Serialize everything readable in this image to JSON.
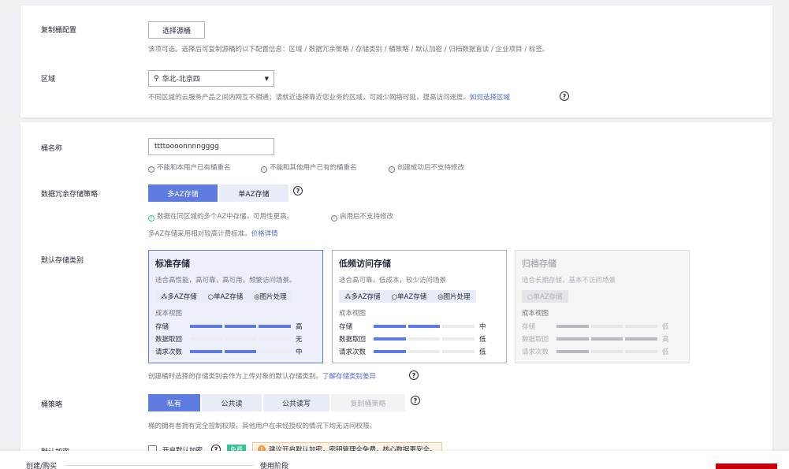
{
  "replicate": {
    "label": "复制桶配置",
    "button": "选择源桶",
    "hint": "该项可选。选择后可复制源桶的以下配置信息：区域 / 数据冗余策略 / 存储类别 / 桶策略 / 默认加密 / 归档数据直读 / 企业项目 / 标签。"
  },
  "region": {
    "label": "区域",
    "value": "华北-北京四",
    "hint": "不同区域的云服务产品之间内网互不相通；请就近选择靠近您业务的区域，可减少网络时延，提高访问速度。",
    "link": "如何选择区域"
  },
  "bucket_name": {
    "label": "桶名称",
    "value": "ttttoooonnnngggg",
    "rules": [
      "不能和本用户已有桶重名",
      "不能和其他用户已有的桶重名",
      "创建成功后不支持修改"
    ]
  },
  "redundancy": {
    "label": "数据冗余存储策略",
    "options": [
      "多AZ存储",
      "单AZ存储"
    ],
    "hint_ok": "数据在同区域的多个AZ中存储，可用性更高。",
    "hint_info": "启用后不支持修改",
    "price_hint": "多AZ存储采用相对较高计费标准。",
    "price_link": "价格详情"
  },
  "storage_class": {
    "label": "默认存储类别",
    "cost_title": "成本视图",
    "cards": [
      {
        "title": "标准存储",
        "desc": "适合高性能，高可靠，高可用，频繁访问场景。",
        "tags": [
          "⁂多AZ存储",
          "○单AZ存储",
          "◎图片处理"
        ],
        "rows": [
          {
            "name": "存储",
            "level": 3,
            "value": "高"
          },
          {
            "name": "数据取回",
            "level": 0,
            "value": "无"
          },
          {
            "name": "请求次数",
            "level": 2,
            "value": "中"
          }
        ]
      },
      {
        "title": "低频访问存储",
        "desc": "适合高可靠，低成本，较少访问场景",
        "tags": [
          "⁂多AZ存储",
          "○单AZ存储",
          "◎图片处理"
        ],
        "rows": [
          {
            "name": "存储",
            "level": 2,
            "value": "中"
          },
          {
            "name": "数据取回",
            "level": 1,
            "value": "低"
          },
          {
            "name": "请求次数",
            "level": 1,
            "value": "低"
          }
        ]
      },
      {
        "title": "归档存储",
        "desc": "适合长期存储，基本不访问场景",
        "tags": [
          "○单AZ存储"
        ],
        "rows": [
          {
            "name": "存储",
            "level": 1,
            "value": "低"
          },
          {
            "name": "数据取回",
            "level": 3,
            "value": "高"
          },
          {
            "name": "请求次数",
            "level": 1,
            "value": "低"
          }
        ]
      }
    ],
    "hint": "创建桶时选择的存储类别会作为上传对象的默认存储类别。",
    "link": "了解存储类别差异"
  },
  "policy": {
    "label": "桶策略",
    "options": [
      "私有",
      "公共读",
      "公共读写",
      "复制桶策略"
    ],
    "hint": "桶的拥有者拥有完全控制权限，其他用户在未经授权的情况下均无访问权限。"
  },
  "encryption": {
    "label": "默认加密",
    "checkbox_label": "开启默认加密",
    "badge": "免费",
    "warning": "建议开启默认加密，密钥管理全免费，核心数据更安全。"
  },
  "footer": {
    "step1": "创建/购买",
    "step2": "使用阶段"
  },
  "colors": {
    "primary": "#5e7ce0",
    "buy_button": "#c7000b",
    "success": "#3ac295",
    "warning": "#fa9841"
  }
}
